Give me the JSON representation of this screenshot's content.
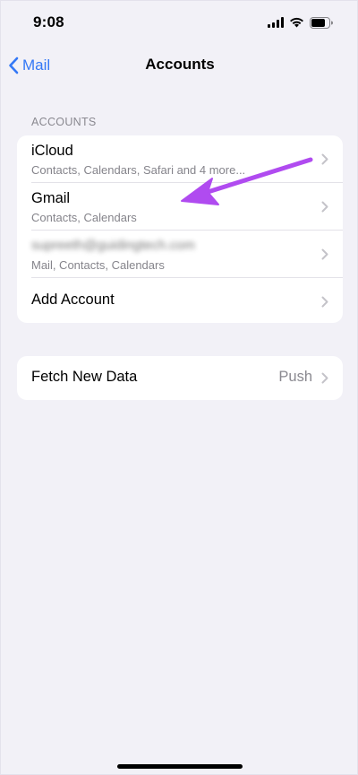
{
  "status_bar": {
    "time": "9:08",
    "icons": [
      "cellular-signal-icon",
      "wifi-icon",
      "battery-icon"
    ]
  },
  "nav": {
    "back_label": "Mail",
    "title": "Accounts"
  },
  "accounts_section": {
    "header": "ACCOUNTS",
    "rows": [
      {
        "title": "iCloud",
        "subtitle": "Contacts, Calendars, Safari and 4 more..."
      },
      {
        "title": "Gmail",
        "subtitle": "Contacts, Calendars"
      },
      {
        "title": "supreeth@guidingtech.com",
        "subtitle": "Mail, Contacts, Calendars",
        "blurred": true
      },
      {
        "title": "Add Account"
      }
    ]
  },
  "fetch_section": {
    "title": "Fetch New Data",
    "value": "Push"
  },
  "colors": {
    "background": "#f2f1f7",
    "accent": "#3478f6",
    "annotation": "#b04bf0",
    "chevron": "#c4c3c9"
  }
}
